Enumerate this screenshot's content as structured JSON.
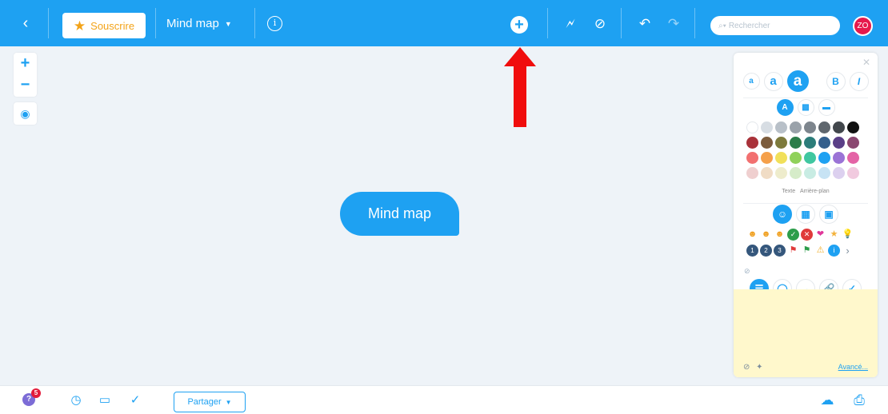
{
  "topbar": {
    "back_icon": "chevron-left-icon",
    "subscribe_label": "Souscrire",
    "map_title": "Mind map",
    "search_placeholder": "Rechercher",
    "avatar_initials": "ZO",
    "colors": {
      "bar": "#1ea1f2",
      "subscribe": "#f3a318",
      "avatar": "#e6194d"
    }
  },
  "canvas": {
    "central_node": "Mind map"
  },
  "format_panel": {
    "text_size_buttons": [
      "a",
      "a",
      "a"
    ],
    "bold_label": "B",
    "italic_label": "I",
    "color_rows": [
      [
        "#ffffff",
        "#d7dde3",
        "#b8c0c8",
        "#9aa2aa",
        "#7d858d",
        "#5f666d",
        "#42474c",
        "#111111"
      ],
      [
        "#a9323a",
        "#7c5c3c",
        "#7d7a3c",
        "#2c7d4a",
        "#2c7d7a",
        "#345f8c",
        "#5a3f87",
        "#8a4770"
      ],
      [
        "#f27070",
        "#f5a04a",
        "#f1e05a",
        "#8fd15a",
        "#40c7a0",
        "#1ea1f2",
        "#9b73d6",
        "#e463a6"
      ],
      [
        "#efcfcf",
        "#f0dcc5",
        "#eeeccc",
        "#d6ecc9",
        "#c8ece3",
        "#c7e3f4",
        "#dcd0ef",
        "#f1cadf"
      ]
    ],
    "color_tab_text": "Texte",
    "color_tab_background": "Arrière-plan",
    "advanced_link": "Avancé..."
  },
  "bottombar": {
    "help_badge_count": "5",
    "help_label": "?",
    "share_label": "Partager"
  }
}
